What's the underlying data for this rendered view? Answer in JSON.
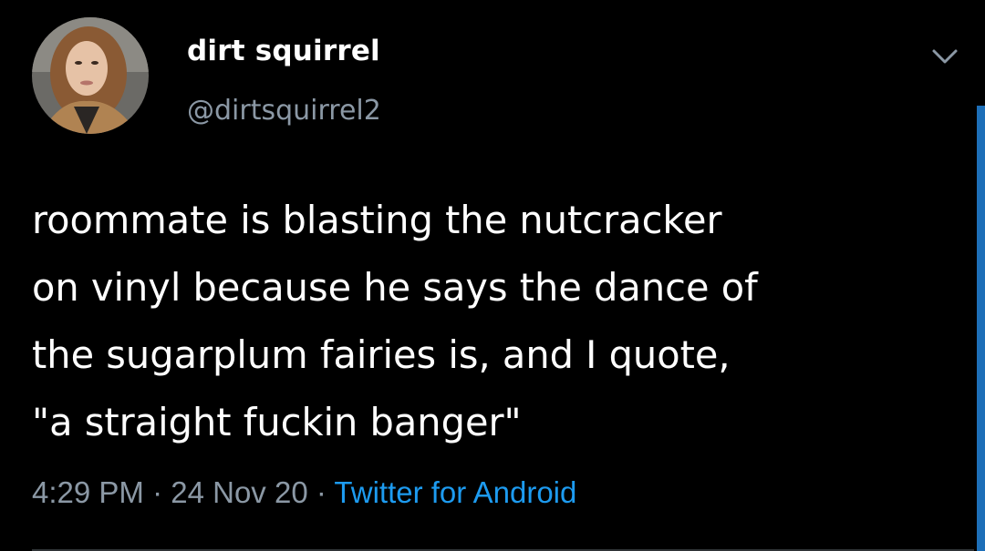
{
  "tweet": {
    "author": {
      "display_name": "dirt squirrel",
      "handle": "@dirtsquirrel2",
      "avatar_icon": "profile-photo"
    },
    "text": "roommate is blasting the nutcracker\non vinyl because he says the dance of\nthe sugarplum fairies is, and I quote,\n\"a straight fuckin banger\"",
    "time": "4:29 PM",
    "separator": " · ",
    "date": "24 Nov 20",
    "source": "Twitter for Android",
    "menu_icon": "chevron-down-icon"
  },
  "colors": {
    "background": "#000000",
    "text": "#ffffff",
    "secondary": "#8b98a5",
    "link": "#1d9bf0",
    "scrollbar": "#1d6fb8"
  }
}
